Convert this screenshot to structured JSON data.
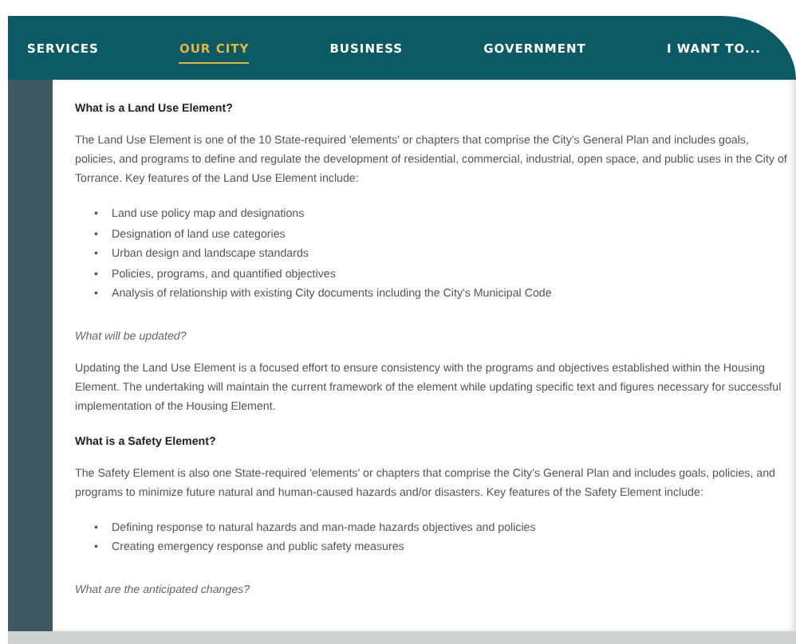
{
  "nav": {
    "items": [
      {
        "label": "SERVICES",
        "selected": false
      },
      {
        "label": "OUR CITY",
        "selected": true
      },
      {
        "label": "BUSINESS",
        "selected": false
      },
      {
        "label": "GOVERNMENT",
        "selected": false
      },
      {
        "label": "I WANT TO...",
        "selected": false
      }
    ]
  },
  "content": [
    {
      "kind": "heading",
      "text": "What is a Land Use Element?"
    },
    {
      "kind": "paragraph",
      "text": "The Land Use Element is one of the 10 State-required 'elements' or chapters that comprise the City's General Plan and includes goals, policies, and programs to define and regulate the development of residential, commercial, industrial, open space, and public uses in the City of Torrance. Key features of the Land Use Element include:"
    },
    {
      "kind": "list",
      "marker": "•",
      "items": [
        "Land use policy map and designations",
        "Designation of land use categories",
        "Urban design and landscape standards",
        "Policies, programs, and quantified objectives",
        "Analysis of relationship with existing City documents including the City's Municipal Code"
      ]
    },
    {
      "kind": "question",
      "text": "What will be updated?"
    },
    {
      "kind": "paragraph",
      "text": "Updating the Land Use Element is a focused effort to ensure consistency with the programs and objectives established within the Housing Element. The undertaking will maintain the current framework of the element while updating specific text and figures necessary for successful implementation of the Housing Element."
    },
    {
      "kind": "heading",
      "text": "What is a Safety Element?"
    },
    {
      "kind": "paragraph",
      "text": "The Safety Element is also one State-required 'elements' or chapters that comprise the City's General Plan and includes goals, policies, and programs to minimize future natural and human-caused hazards and/or disasters. Key features of the Safety Element include:"
    },
    {
      "kind": "list",
      "marker": "•",
      "items": [
        "Defining response to natural hazards and man-made hazards objectives and policies",
        "Creating emergency response and public safety measures"
      ]
    },
    {
      "kind": "question",
      "text": "What are the anticipated changes?"
    }
  ]
}
